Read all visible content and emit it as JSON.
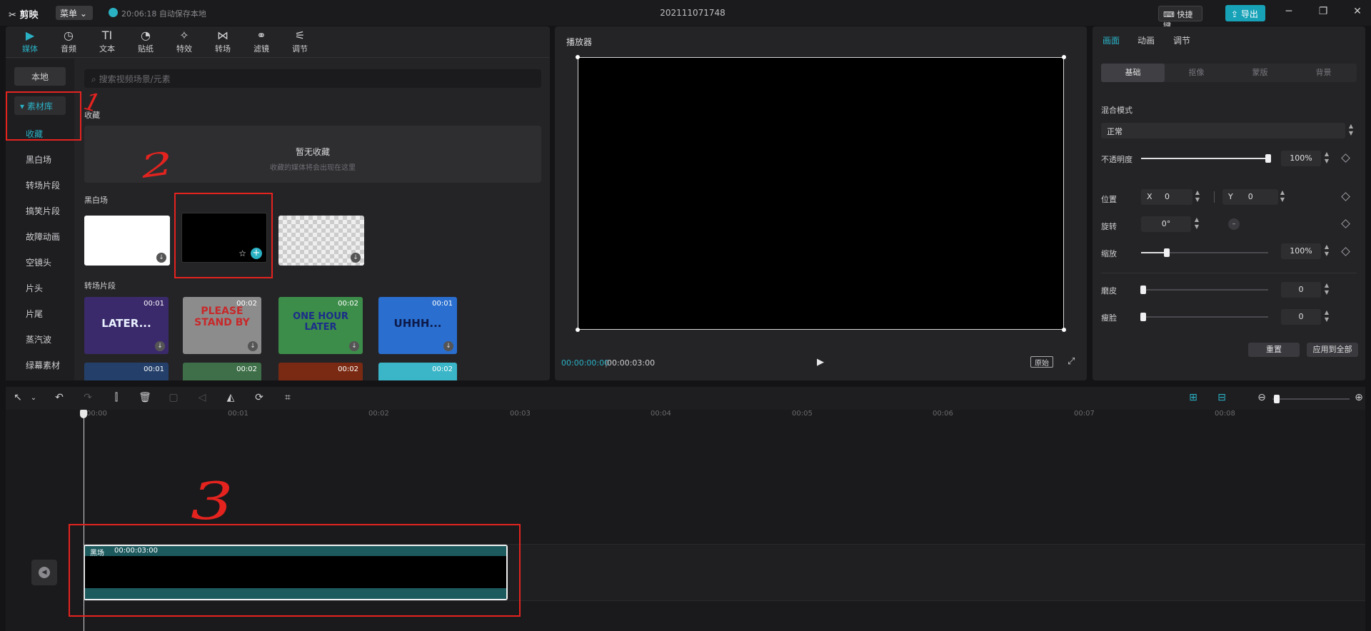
{
  "app": {
    "name": "剪映",
    "menu": "菜单",
    "autosave": "20:06:18 自动保存本地",
    "project_title": "202111071748",
    "shortcut": "快捷键",
    "export": "导出"
  },
  "tabs": [
    {
      "label": "媒体",
      "icon": "media-icon",
      "active": true
    },
    {
      "label": "音频",
      "icon": "audio-icon"
    },
    {
      "label": "文本",
      "icon": "text-icon"
    },
    {
      "label": "贴纸",
      "icon": "sticker-icon"
    },
    {
      "label": "特效",
      "icon": "effects-icon"
    },
    {
      "label": "转场",
      "icon": "transition-icon"
    },
    {
      "label": "滤镜",
      "icon": "filter-icon"
    },
    {
      "label": "调节",
      "icon": "adjust-icon"
    }
  ],
  "nav": {
    "local": "本地",
    "library": "素材库",
    "favorites": "收藏",
    "items": [
      "黑白场",
      "转场片段",
      "搞笑片段",
      "故障动画",
      "空镜头",
      "片头",
      "片尾",
      "蒸汽波",
      "绿幕素材"
    ]
  },
  "search": {
    "placeholder": "搜索视频场景/元素"
  },
  "favorites": {
    "title": "收藏",
    "empty": "暂无收藏",
    "hint": "收藏的媒体将会出现在这里"
  },
  "sections": {
    "blackwhite": "黑白场",
    "transition": "转场片段"
  },
  "transition_clips": [
    {
      "text": "LATER...",
      "duration": "00:01"
    },
    {
      "text": "PLEASE STAND BY",
      "duration": "00:02"
    },
    {
      "text": "ONE HOUR LATER",
      "duration": "00:02"
    },
    {
      "text": "UHHH...",
      "duration": "00:01"
    }
  ],
  "transition_clips_row2": [
    {
      "duration": "00:01"
    },
    {
      "duration": "00:02"
    },
    {
      "duration": "00:02"
    },
    {
      "duration": "00:02"
    }
  ],
  "player": {
    "title": "播放器",
    "current": "00:00:00:00",
    "total": "00:00:03:00",
    "original": "原始"
  },
  "inspector": {
    "tabs": [
      "画面",
      "动画",
      "调节"
    ],
    "subtabs": [
      "基础",
      "抠像",
      "蒙版",
      "背景"
    ],
    "blend_label": "混合模式",
    "blend_value": "正常",
    "opacity_label": "不透明度",
    "opacity_value": "100%",
    "opacity": 1.0,
    "position_label": "位置",
    "x_label": "X",
    "x_value": "0",
    "y_label": "Y",
    "y_value": "0",
    "rotate_label": "旋转",
    "rotate_value": "0°",
    "scale_label": "缩放",
    "scale_value": "100%",
    "scale": 0.2,
    "smooth_label": "磨皮",
    "smooth_value": "0",
    "slim_label": "瘦脸",
    "slim_value": "0",
    "reset": "重置",
    "apply_all": "应用到全部"
  },
  "timeline": {
    "ticks": [
      "00:00",
      "00:01",
      "00:02",
      "00:03",
      "00:04",
      "00:05",
      "00:06",
      "00:07",
      "00:08"
    ],
    "clip": {
      "label": "黑场",
      "duration": "00:00:03:00"
    }
  },
  "annotations": [
    "1",
    "2",
    "3"
  ],
  "colors": {
    "accent": "#2ab1c4",
    "export": "#17a2b8",
    "annotation": "#e4231f",
    "clip": "#1d5a5e"
  }
}
